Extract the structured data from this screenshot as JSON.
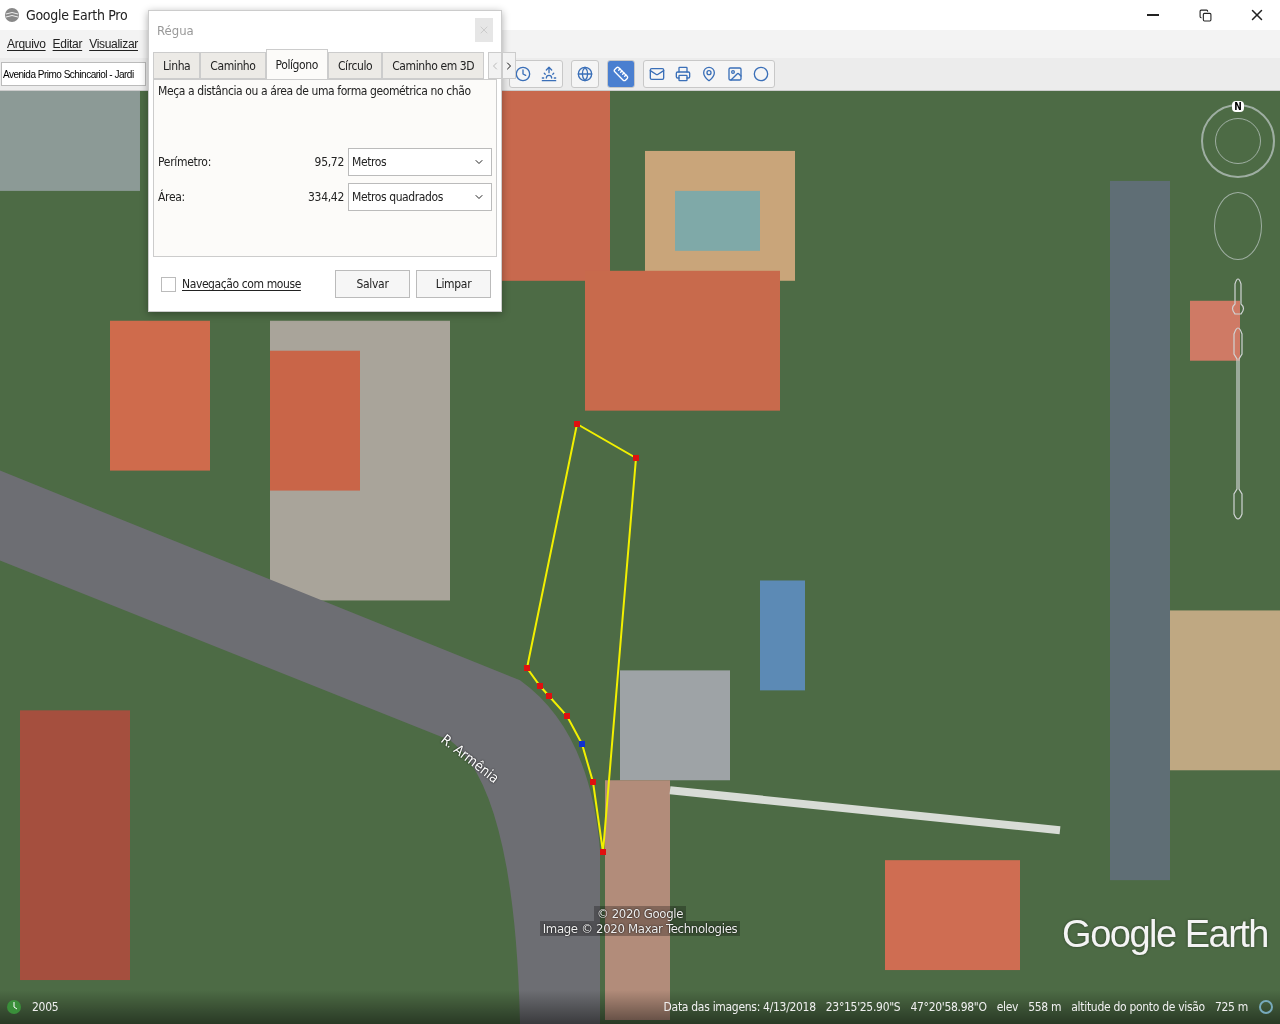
{
  "window": {
    "title": "Google Earth Pro"
  },
  "menu": [
    {
      "label": "Arquivo"
    },
    {
      "label": "Editar"
    },
    {
      "label": "Visualizar"
    }
  ],
  "search": {
    "value": "Avenida Primo Schincariol - Jardi"
  },
  "toolbar": [
    [
      {
        "selected": false
      },
      {
        "selected": false
      }
    ],
    [
      {
        "selected": false
      }
    ],
    [
      {
        "selected": true
      }
    ],
    [
      {
        "selected": false
      },
      {
        "selected": false
      },
      {
        "selected": false
      },
      {
        "selected": false
      },
      {
        "selected": false
      }
    ]
  ],
  "dialog": {
    "title": "Régua",
    "tabs": [
      {
        "label": "Linha",
        "selected": false
      },
      {
        "label": "Caminho",
        "selected": false
      },
      {
        "label": "Polígono",
        "selected": true
      },
      {
        "label": "Círculo",
        "selected": false
      },
      {
        "label": "Caminho em 3D",
        "selected": false
      }
    ],
    "description": "Meça a distância ou a área de uma forma geométrica no chão",
    "measures": [
      {
        "label": "Perímetro:",
        "value": "95,72",
        "unit": "Metros"
      },
      {
        "label": "Área:",
        "value": "334,42",
        "unit": "Metros quadrados"
      }
    ],
    "mouse_navigation": {
      "label": "Navegação com mouse",
      "checked": false
    },
    "buttons": [
      "Salvar",
      "Limpar"
    ]
  },
  "map": {
    "street_label": "R. Armênia",
    "compass_label": "N",
    "copyright": [
      "© 2020 Google",
      "Image © 2020 Maxar Technologies"
    ],
    "logo": "Google Earth"
  },
  "status_bar": {
    "history_year": "2005",
    "image_date": "Data das imagens: 4/13/2018",
    "latitude": "23°15'25.90\"S",
    "longitude": "47°20'58.98\"O",
    "elevation_label": "elev",
    "elevation": "558 m",
    "eye_altitude_label": "altitude do ponto de visão",
    "eye_altitude": "725 m"
  }
}
